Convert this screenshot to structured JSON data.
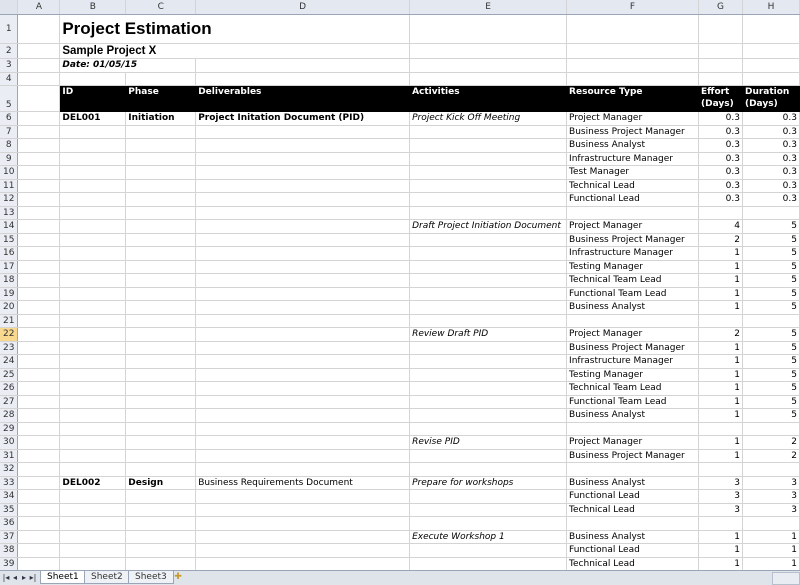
{
  "columns": [
    "A",
    "B",
    "C",
    "D",
    "E",
    "F",
    "G",
    "H"
  ],
  "title": "Project Estimation",
  "subtitle": "Sample Project X",
  "date": "Date: 01/05/15",
  "headers": {
    "id": "ID",
    "phase": "Phase",
    "deliverables": "Deliverables",
    "activities": "Activities",
    "resource_type": "Resource Type",
    "effort": "Effort",
    "effort_unit": "(Days)",
    "duration": "Duration",
    "duration_unit": "(Days)"
  },
  "rows": [
    {
      "n": "6",
      "id": "DEL001",
      "phase": "Initiation",
      "deliverable": "Project Initation Document (PID)",
      "activity": "Project Kick Off Meeting",
      "resource": "Project Manager",
      "effort": "0.3",
      "duration": "0.3"
    },
    {
      "n": "7",
      "id": "",
      "phase": "",
      "deliverable": "",
      "activity": "",
      "resource": "Business Project Manager",
      "effort": "0.3",
      "duration": "0.3"
    },
    {
      "n": "8",
      "id": "",
      "phase": "",
      "deliverable": "",
      "activity": "",
      "resource": "Business Analyst",
      "effort": "0.3",
      "duration": "0.3"
    },
    {
      "n": "9",
      "id": "",
      "phase": "",
      "deliverable": "",
      "activity": "",
      "resource": "Infrastructure Manager",
      "effort": "0.3",
      "duration": "0.3"
    },
    {
      "n": "10",
      "id": "",
      "phase": "",
      "deliverable": "",
      "activity": "",
      "resource": "Test Manager",
      "effort": "0.3",
      "duration": "0.3"
    },
    {
      "n": "11",
      "id": "",
      "phase": "",
      "deliverable": "",
      "activity": "",
      "resource": "Technical Lead",
      "effort": "0.3",
      "duration": "0.3"
    },
    {
      "n": "12",
      "id": "",
      "phase": "",
      "deliverable": "",
      "activity": "",
      "resource": "Functional Lead",
      "effort": "0.3",
      "duration": "0.3"
    },
    {
      "n": "13",
      "id": "",
      "phase": "",
      "deliverable": "",
      "activity": "",
      "resource": "",
      "effort": "",
      "duration": ""
    },
    {
      "n": "14",
      "id": "",
      "phase": "",
      "deliverable": "",
      "activity": "Draft Project Initiation Document",
      "resource": "Project Manager",
      "effort": "4",
      "duration": "5"
    },
    {
      "n": "15",
      "id": "",
      "phase": "",
      "deliverable": "",
      "activity": "",
      "resource": "Business Project Manager",
      "effort": "2",
      "duration": "5"
    },
    {
      "n": "16",
      "id": "",
      "phase": "",
      "deliverable": "",
      "activity": "",
      "resource": "Infrastructure Manager",
      "effort": "1",
      "duration": "5"
    },
    {
      "n": "17",
      "id": "",
      "phase": "",
      "deliverable": "",
      "activity": "",
      "resource": "Testing Manager",
      "effort": "1",
      "duration": "5"
    },
    {
      "n": "18",
      "id": "",
      "phase": "",
      "deliverable": "",
      "activity": "",
      "resource": "Technical Team Lead",
      "effort": "1",
      "duration": "5"
    },
    {
      "n": "19",
      "id": "",
      "phase": "",
      "deliverable": "",
      "activity": "",
      "resource": "Functional Team Lead",
      "effort": "1",
      "duration": "5"
    },
    {
      "n": "20",
      "id": "",
      "phase": "",
      "deliverable": "",
      "activity": "",
      "resource": "Business Analyst",
      "effort": "1",
      "duration": "5"
    },
    {
      "n": "21",
      "id": "",
      "phase": "",
      "deliverable": "",
      "activity": "",
      "resource": "",
      "effort": "",
      "duration": ""
    },
    {
      "n": "22",
      "id": "",
      "phase": "",
      "deliverable": "",
      "activity": "Review Draft PID",
      "resource": "Project Manager",
      "effort": "2",
      "duration": "5"
    },
    {
      "n": "23",
      "id": "",
      "phase": "",
      "deliverable": "",
      "activity": "",
      "resource": "Business Project Manager",
      "effort": "1",
      "duration": "5"
    },
    {
      "n": "24",
      "id": "",
      "phase": "",
      "deliverable": "",
      "activity": "",
      "resource": "Infrastructure Manager",
      "effort": "1",
      "duration": "5"
    },
    {
      "n": "25",
      "id": "",
      "phase": "",
      "deliverable": "",
      "activity": "",
      "resource": "Testing Manager",
      "effort": "1",
      "duration": "5"
    },
    {
      "n": "26",
      "id": "",
      "phase": "",
      "deliverable": "",
      "activity": "",
      "resource": "Technical Team Lead",
      "effort": "1",
      "duration": "5"
    },
    {
      "n": "27",
      "id": "",
      "phase": "",
      "deliverable": "",
      "activity": "",
      "resource": "Functional Team Lead",
      "effort": "1",
      "duration": "5"
    },
    {
      "n": "28",
      "id": "",
      "phase": "",
      "deliverable": "",
      "activity": "",
      "resource": "Business Analyst",
      "effort": "1",
      "duration": "5"
    },
    {
      "n": "29",
      "id": "",
      "phase": "",
      "deliverable": "",
      "activity": "",
      "resource": "",
      "effort": "",
      "duration": ""
    },
    {
      "n": "30",
      "id": "",
      "phase": "",
      "deliverable": "",
      "activity": "Revise PID",
      "resource": "Project Manager",
      "effort": "1",
      "duration": "2"
    },
    {
      "n": "31",
      "id": "",
      "phase": "",
      "deliverable": "",
      "activity": "",
      "resource": "Business Project Manager",
      "effort": "1",
      "duration": "2"
    },
    {
      "n": "32",
      "id": "",
      "phase": "",
      "deliverable": "",
      "activity": "",
      "resource": "",
      "effort": "",
      "duration": ""
    },
    {
      "n": "33",
      "id": "DEL002",
      "phase": "Design",
      "deliverable": "Business Requirements Document",
      "activity": "Prepare for workshops",
      "resource": "Business Analyst",
      "effort": "3",
      "duration": "3"
    },
    {
      "n": "34",
      "id": "",
      "phase": "",
      "deliverable": "",
      "activity": "",
      "resource": "Functional Lead",
      "effort": "3",
      "duration": "3"
    },
    {
      "n": "35",
      "id": "",
      "phase": "",
      "deliverable": "",
      "activity": "",
      "resource": "Technical Lead",
      "effort": "3",
      "duration": "3"
    },
    {
      "n": "36",
      "id": "",
      "phase": "",
      "deliverable": "",
      "activity": "",
      "resource": "",
      "effort": "",
      "duration": ""
    },
    {
      "n": "37",
      "id": "",
      "phase": "",
      "deliverable": "",
      "activity": "Execute Workshop 1",
      "resource": "Business Analyst",
      "effort": "1",
      "duration": "1"
    },
    {
      "n": "38",
      "id": "",
      "phase": "",
      "deliverable": "",
      "activity": "",
      "resource": "Functional Lead",
      "effort": "1",
      "duration": "1"
    },
    {
      "n": "39",
      "id": "",
      "phase": "",
      "deliverable": "",
      "activity": "",
      "resource": "Technical Lead",
      "effort": "1",
      "duration": "1"
    }
  ],
  "sheet_tabs": [
    "Sheet1",
    "Sheet2",
    "Sheet3"
  ],
  "active_row": "22",
  "nav_icons": [
    "first-sheet-icon",
    "prev-sheet-icon",
    "next-sheet-icon",
    "last-sheet-icon"
  ]
}
